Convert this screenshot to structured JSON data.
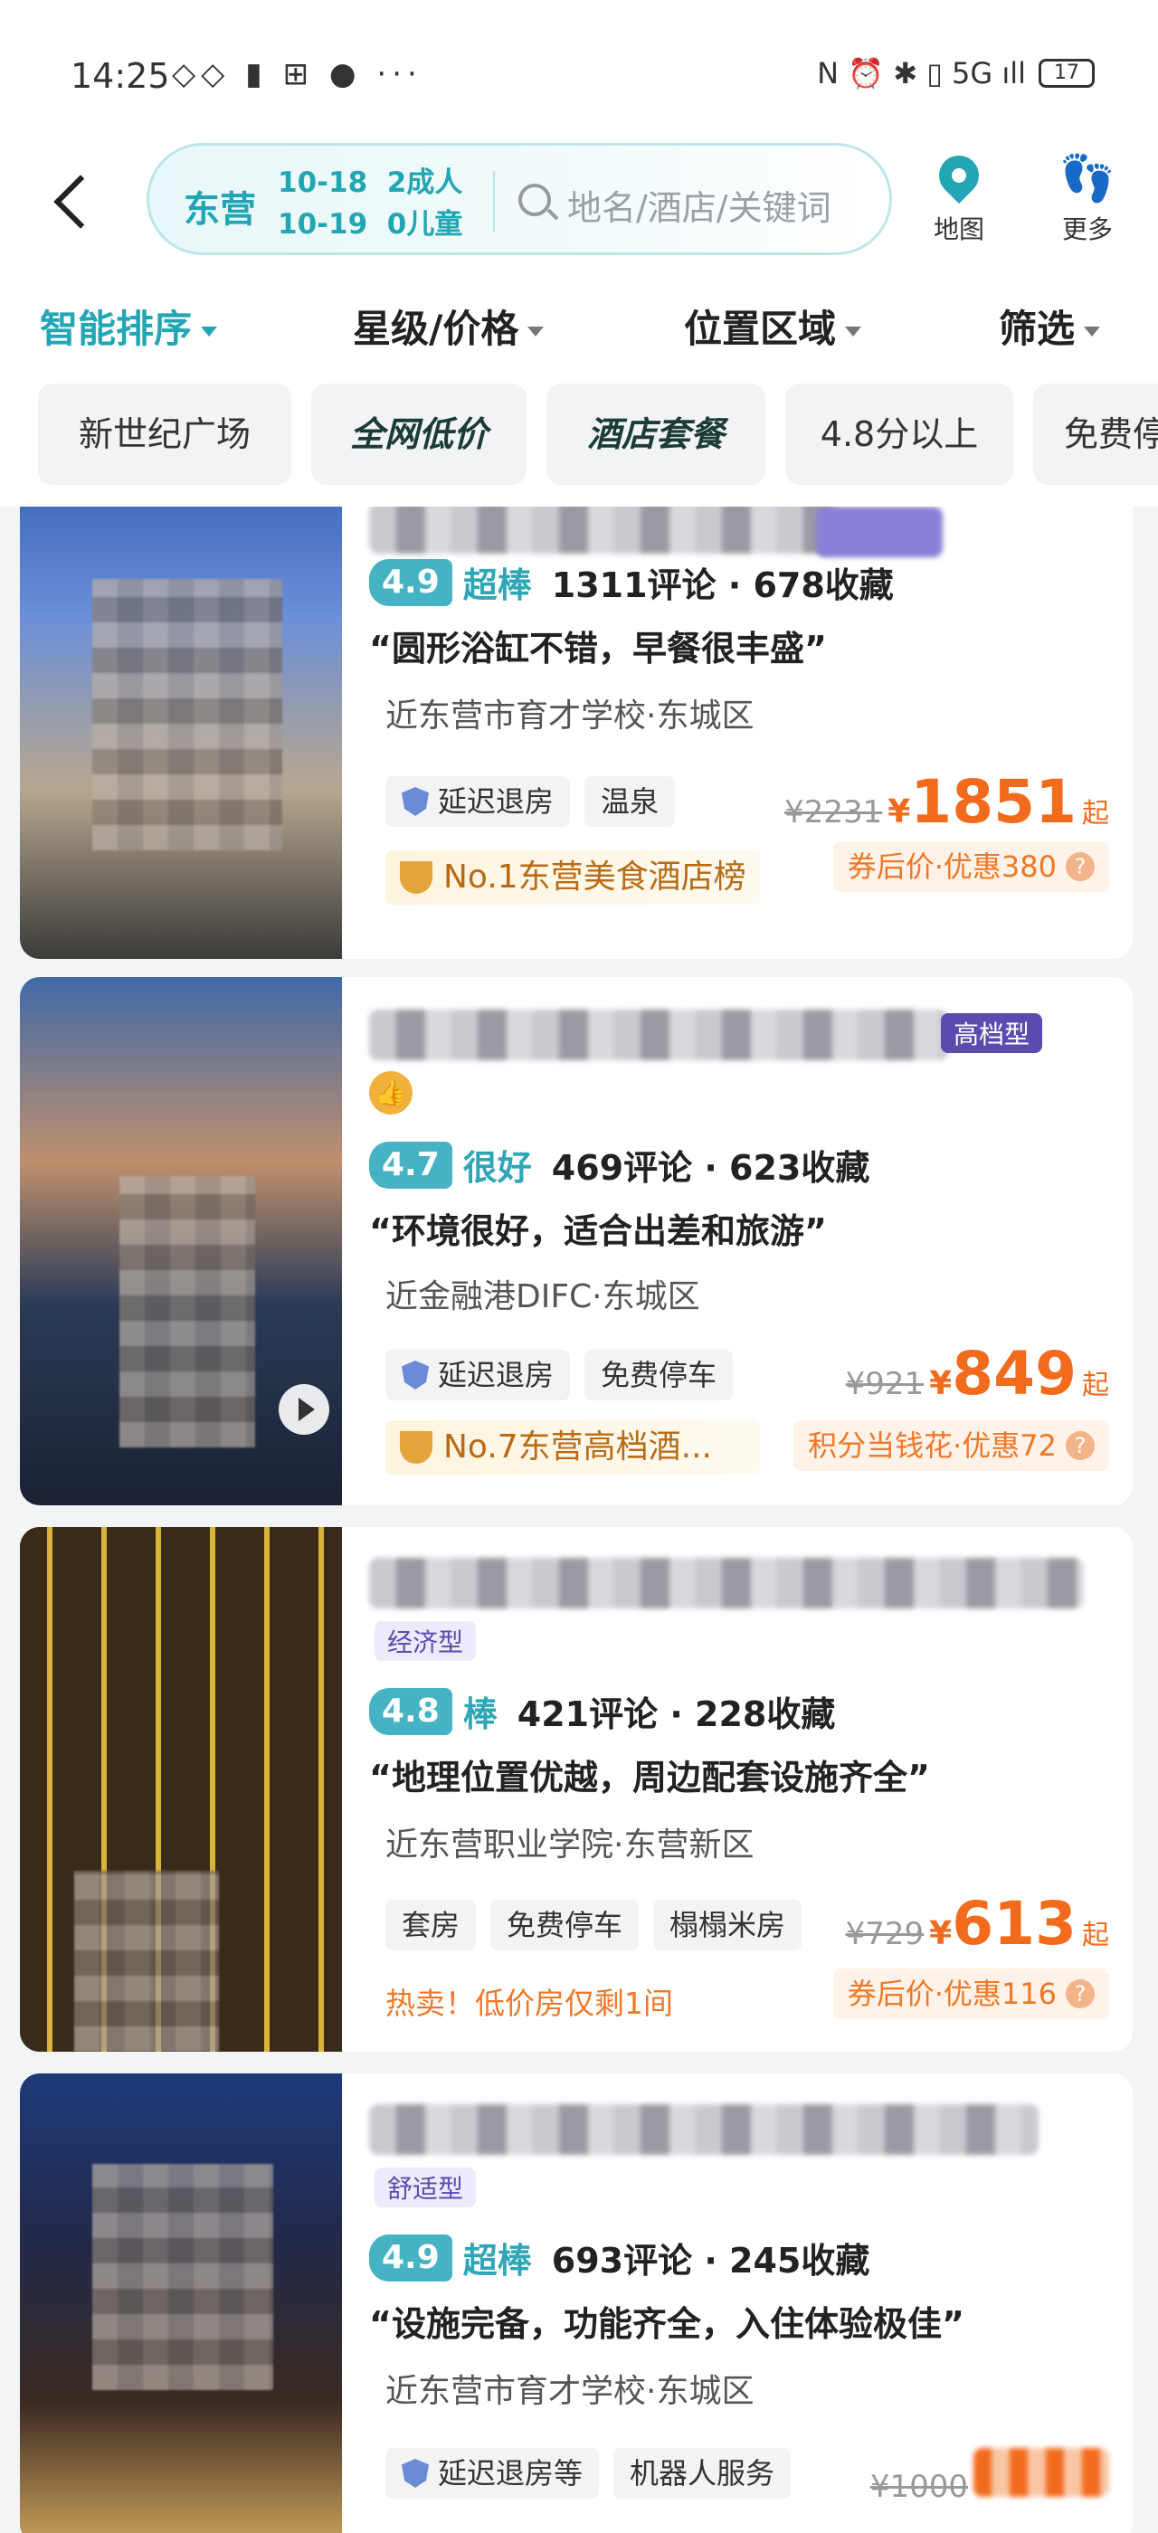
{
  "status_bar": {
    "time": "14:25",
    "left_icons": "◇◇ ▮ ⊞ ● ···",
    "right_icons": "N ⏰ ✱ ▯ 5G ıll",
    "battery": "17"
  },
  "header": {
    "back_icon": "chevron-left-icon",
    "city": "东营",
    "date_in": "10-18",
    "date_out": "10-19",
    "adults": "2成人",
    "children": "0儿童",
    "search_placeholder": "地名/酒店/关键词",
    "map_label": "地图",
    "more_label": "更多"
  },
  "sort_tabs": [
    {
      "label": "智能排序",
      "active": true
    },
    {
      "label": "星级/价格"
    },
    {
      "label": "位置区域"
    },
    {
      "label": "筛选"
    }
  ],
  "chips": [
    "新世纪广场",
    "全网低价",
    "酒店套餐",
    "4.8分以上",
    "免费停车"
  ],
  "hotels": [
    {
      "score": "4.9",
      "score_word": "超棒",
      "reviews": "1311评论 · 678收藏",
      "quote": "“圆形浴缸不错，早餐很丰盛”",
      "location": "近东营市育才学校·东城区",
      "tags": [
        "延迟退房",
        "温泉"
      ],
      "rank": "No.1东营美食酒店榜",
      "orig_price": "¥2231",
      "price": "1851",
      "price_suffix": "起",
      "promo": "券后价·优惠380"
    },
    {
      "type": "高档型",
      "score": "4.7",
      "score_word": "很好",
      "reviews": "469评论 · 623收藏",
      "quote": "“环境很好，适合出差和旅游”",
      "location": "近金融港DIFC·东城区",
      "tags": [
        "延迟退房",
        "免费停车"
      ],
      "rank": "No.7东营高档酒...",
      "orig_price": "¥921",
      "price": "849",
      "price_suffix": "起",
      "promo": "积分当钱花·优惠72"
    },
    {
      "type": "经济型",
      "score": "4.8",
      "score_word": "棒",
      "reviews": "421评论 · 228收藏",
      "quote": "“地理位置优越，周边配套设施齐全”",
      "location": "近东营职业学院·东营新区",
      "tags": [
        "套房",
        "免费停车",
        "榻榻米房"
      ],
      "hot": "热卖！低价房仅剩1间",
      "orig_price": "¥729",
      "price": "613",
      "price_suffix": "起",
      "promo": "券后价·优惠116"
    },
    {
      "type": "舒适型",
      "score": "4.9",
      "score_word": "超棒",
      "reviews": "693评论 · 245收藏",
      "quote": "“设施完备，功能齐全，入住体验极佳”",
      "location": "近东营市育才学校·东城区",
      "tags": [
        "延迟退房等",
        "机器人服务"
      ],
      "orig_price": "¥1000"
    }
  ],
  "colors": {
    "accent": "#22a6b3",
    "price": "#f26b1d"
  }
}
